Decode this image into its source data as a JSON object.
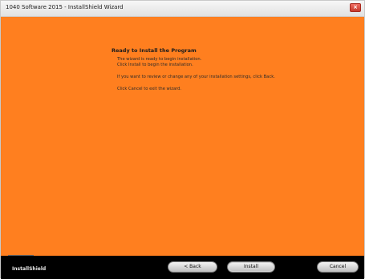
{
  "window": {
    "title": "1040 Software 2015 - InstallShield Wizard",
    "close_label": "×",
    "accent_color": "#ff7f1f"
  },
  "content": {
    "heading": "Ready to Install the Program",
    "line1": "The wizard is ready to begin installation.",
    "line2": "Click Install to begin the installation.",
    "line3": "If you want to review or change any of your installation settings, click Back.",
    "line4": "Click Cancel to exit the wizard."
  },
  "footer": {
    "brand": "InstallShield",
    "back_label": "< Back",
    "install_label": "Install",
    "cancel_label": "Cancel"
  }
}
